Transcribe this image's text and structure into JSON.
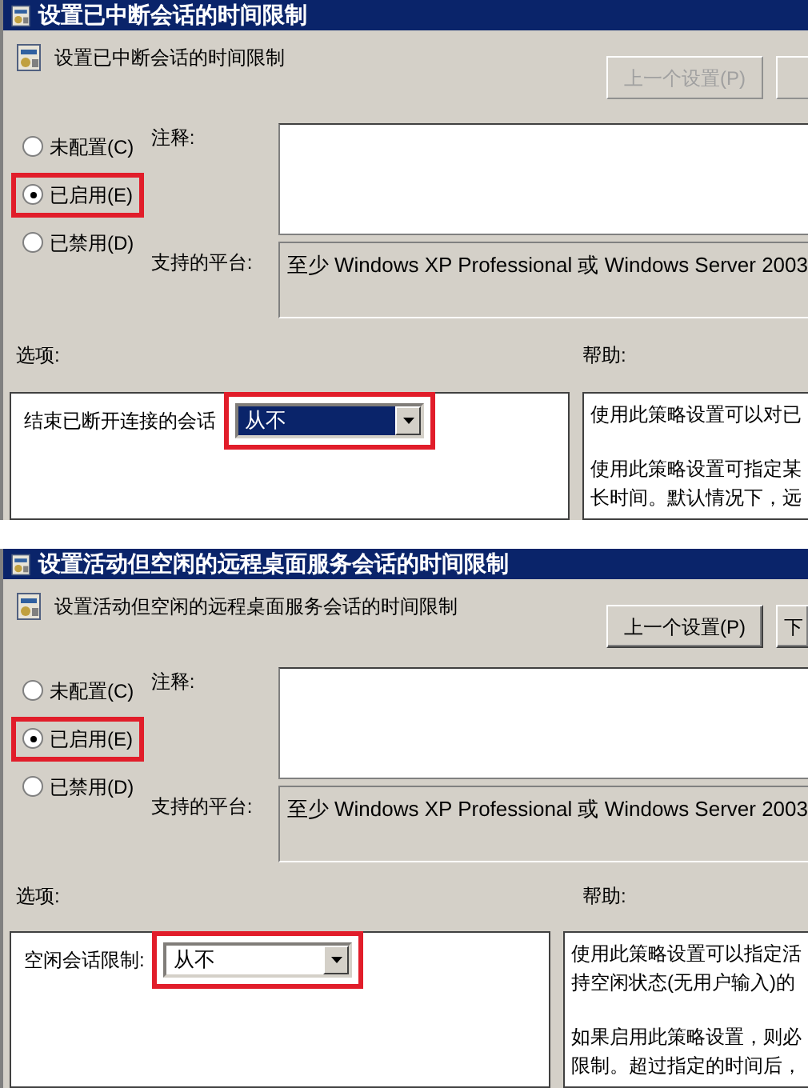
{
  "dialogs": [
    {
      "title": "设置已中断会话的时间限制",
      "heading": "设置已中断会话的时间限制",
      "prev_button": {
        "label": "上一个设置(P)",
        "disabled": true
      },
      "next_button": {
        "disabled": true
      },
      "states": [
        {
          "label": "未配置(C)",
          "selected": false,
          "highlighted": false
        },
        {
          "label": "已启用(E)",
          "selected": true,
          "highlighted": true
        },
        {
          "label": "已禁用(D)",
          "selected": false,
          "highlighted": false
        }
      ],
      "comment_label": "注释:",
      "platform_label": "支持的平台:",
      "platform": "至少 Windows XP Professional 或 Windows Server 2003",
      "options_label": "选项:",
      "help_label": "帮助:",
      "option": {
        "label": "结束已断开连接的会话",
        "value": "从不",
        "focused": true,
        "highlighted": true
      },
      "help": [
        "使用此策略设置可以对已",
        "使用此策略设置可指定某",
        "长时间。默认情况下，远"
      ]
    },
    {
      "title": "设置活动但空闲的远程桌面服务会话的时间限制",
      "heading": "设置活动但空闲的远程桌面服务会话的时间限制",
      "prev_button": {
        "label": "上一个设置(P)",
        "disabled": false
      },
      "next_button": {
        "label": "下",
        "disabled": false
      },
      "states": [
        {
          "label": "未配置(C)",
          "selected": false,
          "highlighted": false
        },
        {
          "label": "已启用(E)",
          "selected": true,
          "highlighted": true
        },
        {
          "label": "已禁用(D)",
          "selected": false,
          "highlighted": false
        }
      ],
      "comment_label": "注释:",
      "platform_label": "支持的平台:",
      "platform": "至少 Windows XP Professional 或 Windows Server 2003",
      "options_label": "选项:",
      "help_label": "帮助:",
      "option": {
        "label": "空闲会话限制:",
        "value": "从不",
        "focused": false,
        "highlighted": true
      },
      "help": [
        "使用此策略设置可以指定活",
        "持空闲状态(无用户输入)的",
        "如果启用此策略设置，则必",
        "限制。超过指定的时间后，"
      ]
    }
  ]
}
